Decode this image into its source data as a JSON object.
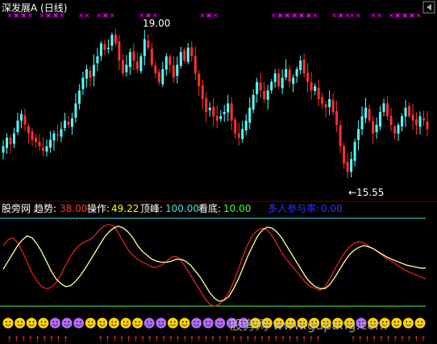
{
  "top_panel": {
    "title": "深发展A (日线)",
    "high_label": "19.00",
    "low_label": "←15.55",
    "marker_glyph": "××"
  },
  "indicator_panel": {
    "name": "股旁网",
    "readouts": [
      {
        "label": "趋势:",
        "value": "38.00",
        "color": "#ff3030"
      },
      {
        "label": "操作:",
        "value": "49.22",
        "color": "#ffff00"
      },
      {
        "label": "顶峰:",
        "value": "100.00",
        "color": "#40e0e0"
      },
      {
        "label": "看底:",
        "value": "10.00",
        "color": "#40ff40"
      },
      {
        "label": "多人参与率:",
        "value": "0.00",
        "color": "#3030ff"
      }
    ]
  },
  "bottom_strip": {
    "watermark": "股旁网 www.gupang.com",
    "face_glyph": "☺"
  },
  "colors": {
    "up_candle": "#54ffff",
    "down_candle": "#ff3030",
    "marker": "#ff00ff",
    "trend_line": "#e02020",
    "operation_line": "#ffffa0",
    "peak_line": "#40e0e0",
    "bottom_line": "#40ff40",
    "face_yellow": "#ffd700",
    "face_purple": "#b36bff",
    "arrow_red": "#ff3030"
  },
  "chart_data": [
    {
      "type": "candlestick",
      "title": "深发展A (日线)",
      "price_range": [
        15.2,
        19.3
      ],
      "annotations": [
        {
          "text": "19.00",
          "value": 19.0
        },
        {
          "text": "←15.55",
          "value": 15.55
        }
      ],
      "closes": [
        16.3,
        16.5,
        16.35,
        16.6,
        16.9,
        17.05,
        16.8,
        16.6,
        16.45,
        16.4,
        16.3,
        16.2,
        16.3,
        16.45,
        16.6,
        16.55,
        16.7,
        16.9,
        16.8,
        16.95,
        17.3,
        17.6,
        17.9,
        18.1,
        17.9,
        18.2,
        18.4,
        18.7,
        18.55,
        18.6,
        18.9,
        18.7,
        18.3,
        18.0,
        18.2,
        18.5,
        18.3,
        18.1,
        18.4,
        18.8,
        18.6,
        18.2,
        18.0,
        17.8,
        18.1,
        18.4,
        18.2,
        17.9,
        18.2,
        18.5,
        18.3,
        18.6,
        18.4,
        18.0,
        17.7,
        17.4,
        17.1,
        17.2,
        17.0,
        16.9,
        17.0,
        17.1,
        17.3,
        16.9,
        16.6,
        16.5,
        16.7,
        16.9,
        17.2,
        17.5,
        17.8,
        17.6,
        17.4,
        17.6,
        17.8,
        18.0,
        17.7,
        17.9,
        18.1,
        17.8,
        17.9,
        18.1,
        18.3,
        18.0,
        17.8,
        17.6,
        17.7,
        17.4,
        17.3,
        17.2,
        17.4,
        17.1,
        16.8,
        16.3,
        15.9,
        15.7,
        16.0,
        16.4,
        16.7,
        17.0,
        17.2,
        16.9,
        16.6,
        16.8,
        17.1,
        17.3,
        17.0,
        16.8,
        16.6,
        16.8,
        17.0,
        17.2,
        17.0,
        16.9,
        16.8,
        17.0,
        16.9,
        16.7
      ],
      "marker_columns": [
        1,
        3,
        5,
        10,
        12,
        14,
        21,
        26,
        28,
        38,
        40,
        55,
        57,
        75,
        77,
        79,
        81,
        83,
        85,
        92,
        94,
        97,
        103,
        108,
        110,
        112,
        114
      ]
    },
    {
      "type": "line",
      "title": "股旁网",
      "y_range": [
        0,
        100
      ],
      "reference_lines": [
        {
          "name": "顶峰",
          "value": 100.0
        },
        {
          "name": "看底",
          "value": 10.0
        }
      ],
      "series": [
        {
          "name": "趋势",
          "values": [
            72,
            78,
            80,
            75,
            66,
            55,
            44,
            36,
            30,
            28,
            29,
            34,
            42,
            52,
            61,
            68,
            73,
            76,
            78,
            82,
            88,
            92,
            94,
            92,
            85,
            76,
            68,
            62,
            58,
            55,
            53,
            50,
            50,
            52,
            56,
            60,
            61,
            57,
            50,
            42,
            34,
            26,
            18,
            12,
            10,
            12,
            17,
            24,
            35,
            48,
            62,
            74,
            83,
            88,
            90,
            88,
            82,
            74,
            65,
            58,
            52,
            46,
            40,
            34,
            30,
            28,
            26,
            30,
            38,
            47,
            56,
            64,
            70,
            74,
            76,
            75,
            72,
            69,
            66,
            62,
            58,
            56,
            52,
            49,
            46,
            44,
            42,
            40,
            38
          ]
        },
        {
          "name": "操作",
          "values": [
            48,
            56,
            64,
            72,
            78,
            82,
            80,
            74,
            66,
            56,
            46,
            38,
            33,
            30,
            31,
            35,
            41,
            48,
            56,
            64,
            72,
            80,
            86,
            90,
            92,
            90,
            86,
            80,
            72,
            66,
            62,
            58,
            56,
            55,
            55,
            56,
            58,
            58,
            56,
            52,
            46,
            40,
            32,
            24,
            18,
            15,
            16,
            20,
            28,
            38,
            50,
            62,
            72,
            82,
            88,
            91,
            90,
            86,
            80,
            72,
            64,
            56,
            48,
            40,
            34,
            30,
            28,
            28,
            32,
            39,
            47,
            55,
            62,
            67,
            70,
            72,
            71,
            69,
            66,
            63,
            60,
            58,
            56,
            54,
            52,
            51,
            50,
            49,
            49
          ]
        }
      ]
    }
  ]
}
